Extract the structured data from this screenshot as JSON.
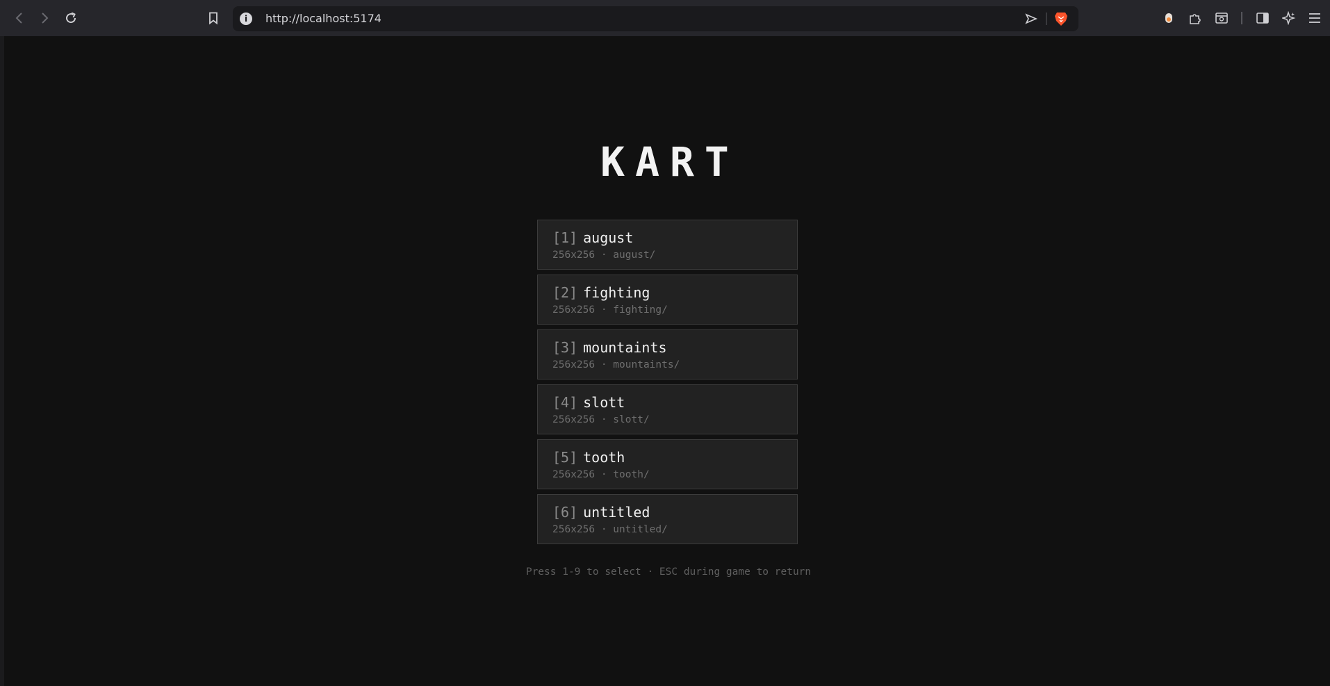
{
  "browser": {
    "url": "http://localhost:5174",
    "info_glyph": "i",
    "icons": {
      "back": "chevron-left-icon",
      "forward": "chevron-right-icon",
      "reload": "reload-icon",
      "bookmark": "bookmark-icon",
      "share": "send-icon",
      "brave": "brave-lion-icon",
      "extension_dot": "extension-dot-icon",
      "extensions": "puzzle-icon",
      "tab_search": "tab-search-icon",
      "sidebar": "sidebar-icon",
      "leo": "sparkle-icon",
      "menu": "hamburger-menu-icon"
    }
  },
  "game": {
    "title": "KART",
    "tracks": [
      {
        "key": "[1]",
        "name": "august",
        "meta": "256x256 · august/"
      },
      {
        "key": "[2]",
        "name": "fighting",
        "meta": "256x256 · fighting/"
      },
      {
        "key": "[3]",
        "name": "mountaints",
        "meta": "256x256 · mountaints/"
      },
      {
        "key": "[4]",
        "name": "slott",
        "meta": "256x256 · slott/"
      },
      {
        "key": "[5]",
        "name": "tooth",
        "meta": "256x256 · tooth/"
      },
      {
        "key": "[6]",
        "name": "untitled",
        "meta": "256x256 · untitled/"
      }
    ],
    "hint": "Press 1-9 to select · ESC during game to return"
  },
  "colors": {
    "page_background": "#111111",
    "card_background": "#222222",
    "card_border": "#3c3c3c",
    "title": "#f2f2f2",
    "key_text": "#8a8a8a",
    "meta_text": "#6e6e6e",
    "brave_orange": "#fb542b"
  }
}
